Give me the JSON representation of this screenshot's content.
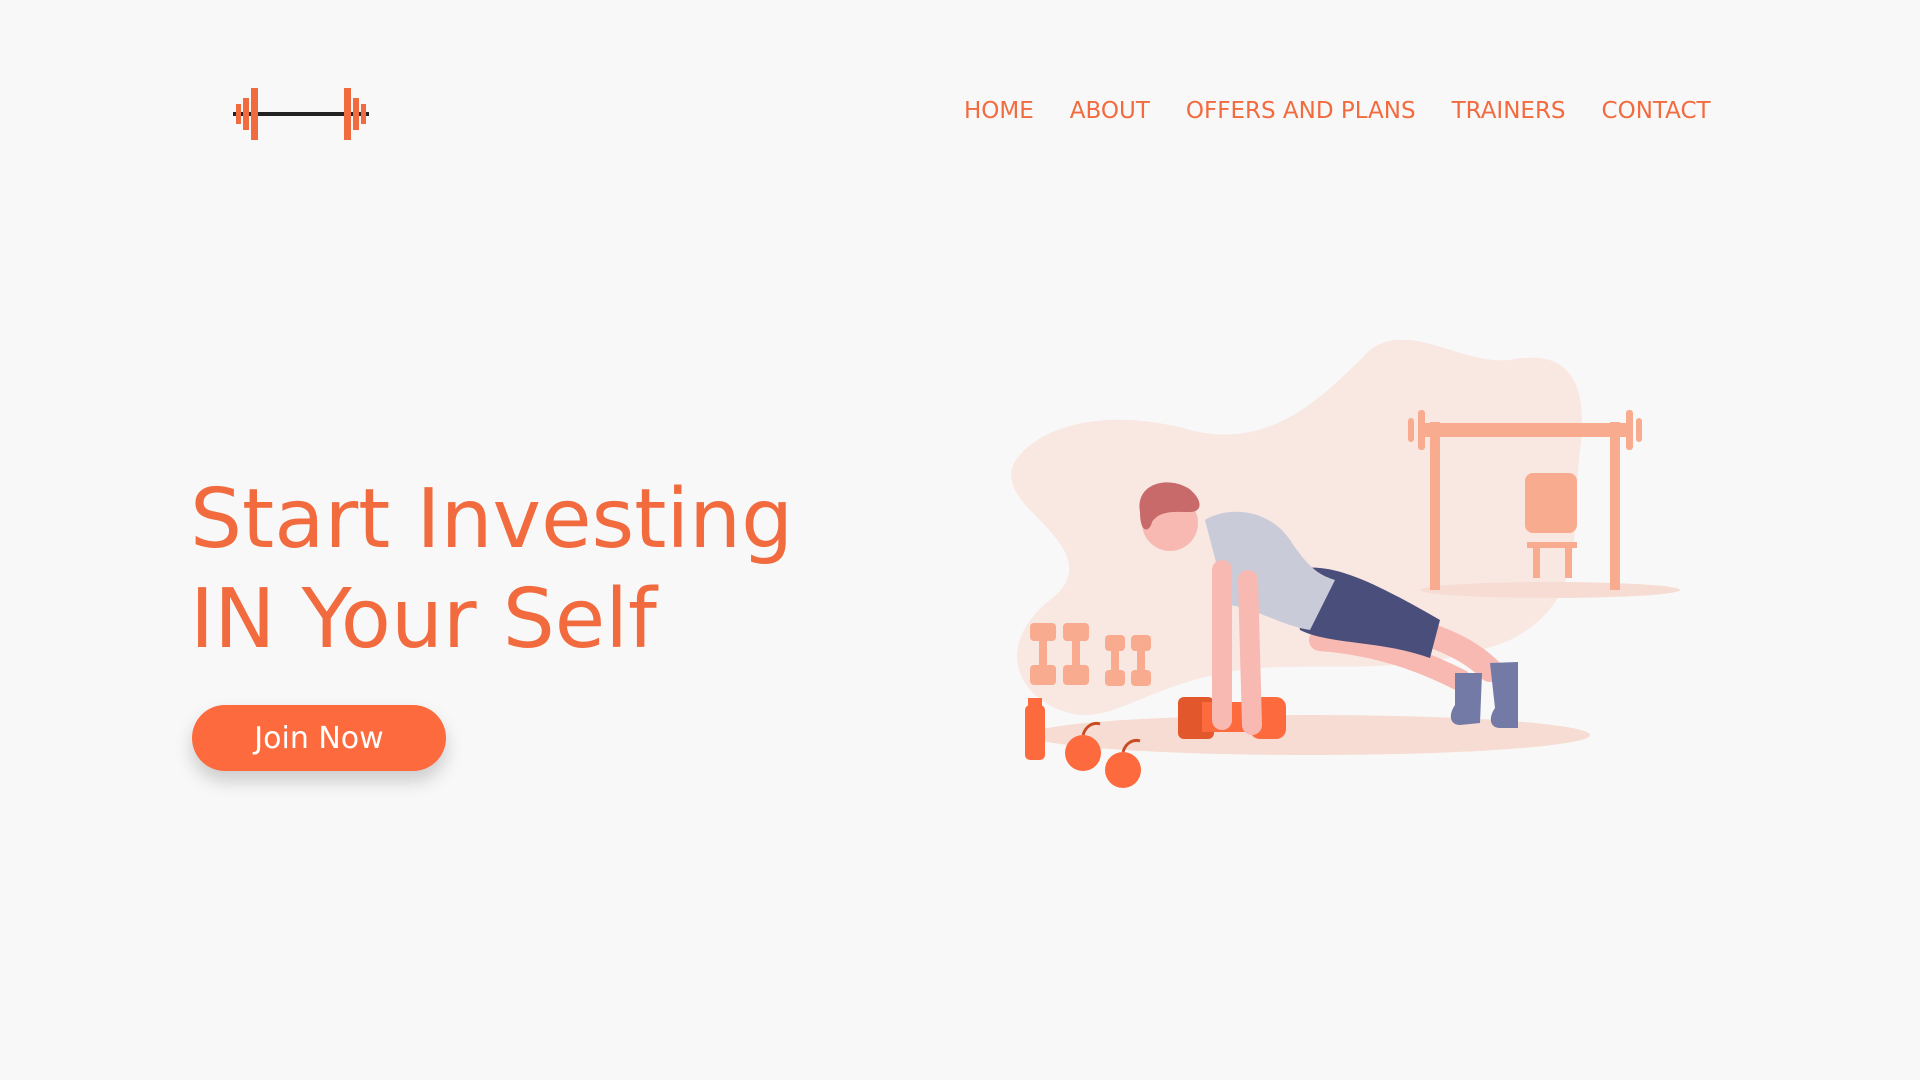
{
  "brand": {
    "logo_icon": "barbell-icon",
    "accent_color": "#f26b3f",
    "button_color": "#fd6a3d"
  },
  "nav": {
    "items": [
      {
        "label": "HOME"
      },
      {
        "label": "ABOUT"
      },
      {
        "label": "OFFERS AND PLANS"
      },
      {
        "label": "TRAINERS"
      },
      {
        "label": "CONTACT"
      }
    ]
  },
  "hero": {
    "title_line1": "Start Investing",
    "title_line2": "IN Your Self",
    "cta_label": "Join Now"
  },
  "illustration": {
    "icon": "person-doing-pushups-illustration"
  }
}
